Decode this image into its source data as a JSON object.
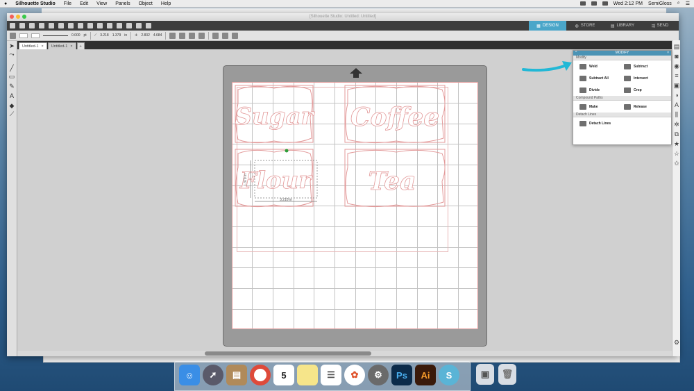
{
  "menubar": {
    "app_name": "Silhouette Studio",
    "items": [
      "File",
      "Edit",
      "View",
      "Panels",
      "Object",
      "Help"
    ],
    "clock": "Wed 2:12 PM",
    "user": "SemiGloss"
  },
  "window": {
    "title": "[Silhouette Studio: Untitled: Untitled]"
  },
  "nav_tabs": [
    "DESIGN",
    "STORE",
    "LIBRARY",
    "SEND"
  ],
  "toolbar": {
    "stroke_width": "0.000",
    "stroke_unit": "pt",
    "width": "3.218",
    "height": "1.379",
    "pos_x": "2.832",
    "pos_y": "4.684",
    "unit": "in"
  },
  "doc_tabs": [
    {
      "label": "Untitled-1",
      "close": "×"
    },
    {
      "label": "Untitled-1",
      "close": "×"
    }
  ],
  "doc_tab_add": "+",
  "labels": [
    "Sugar",
    "Coffee",
    "Flour",
    "Tea"
  ],
  "dimension_labels": {
    "width": "3.218 in",
    "height": "1.379 in"
  },
  "modify_panel": {
    "title": "MODIFY",
    "section_modify": "Modify",
    "weld": "Weld",
    "subtract": "Subtract",
    "subtract_all": "Subtract All",
    "intersect": "Intersect",
    "divide": "Divide",
    "crop": "Crop",
    "section_compound": "Compound Paths",
    "make": "Make",
    "release": "Release",
    "section_detach": "Detach Lines",
    "detach_lines": "Detach Lines"
  },
  "dock": {
    "calendar_day": "5",
    "ps": "Ps",
    "ai": "Ai",
    "silhouette": "S"
  },
  "colors": {
    "accent": "#4aa6c9",
    "arrow": "#22b8d6",
    "cut_line": "#e39a9a",
    "selected_point": "#2e9e3a"
  }
}
